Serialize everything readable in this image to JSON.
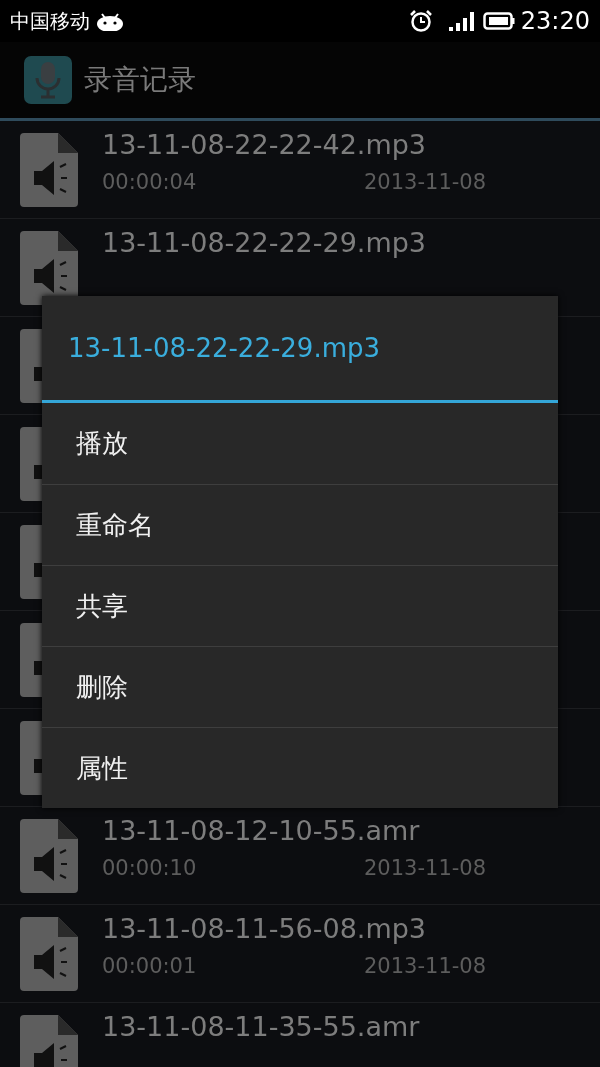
{
  "status_bar": {
    "carrier": "中国移动",
    "time": "23:20"
  },
  "action_bar": {
    "title": "录音记录"
  },
  "recordings": [
    {
      "kind": "entry",
      "title": "13-11-08-22-22-42.mp3",
      "duration": "00:00:04",
      "date": "2013-11-08"
    },
    {
      "kind": "entry",
      "title": "13-11-08-22-22-29.mp3"
    },
    {
      "kind": "covered"
    },
    {
      "kind": "covered"
    },
    {
      "kind": "covered"
    },
    {
      "kind": "covered"
    },
    {
      "kind": "covered"
    },
    {
      "kind": "entry",
      "title": "13-11-08-12-10-55.amr",
      "duration": "00:00:10",
      "date": "2013-11-08"
    },
    {
      "kind": "entry",
      "title": "13-11-08-11-56-08.mp3",
      "duration": "00:00:01",
      "date": "2013-11-08"
    },
    {
      "kind": "entry",
      "title": "13-11-08-11-35-55.amr"
    }
  ],
  "context_menu": {
    "title": "13-11-08-22-22-29.mp3",
    "items": [
      "播放",
      "重命名",
      "共享",
      "删除",
      "属性"
    ]
  }
}
